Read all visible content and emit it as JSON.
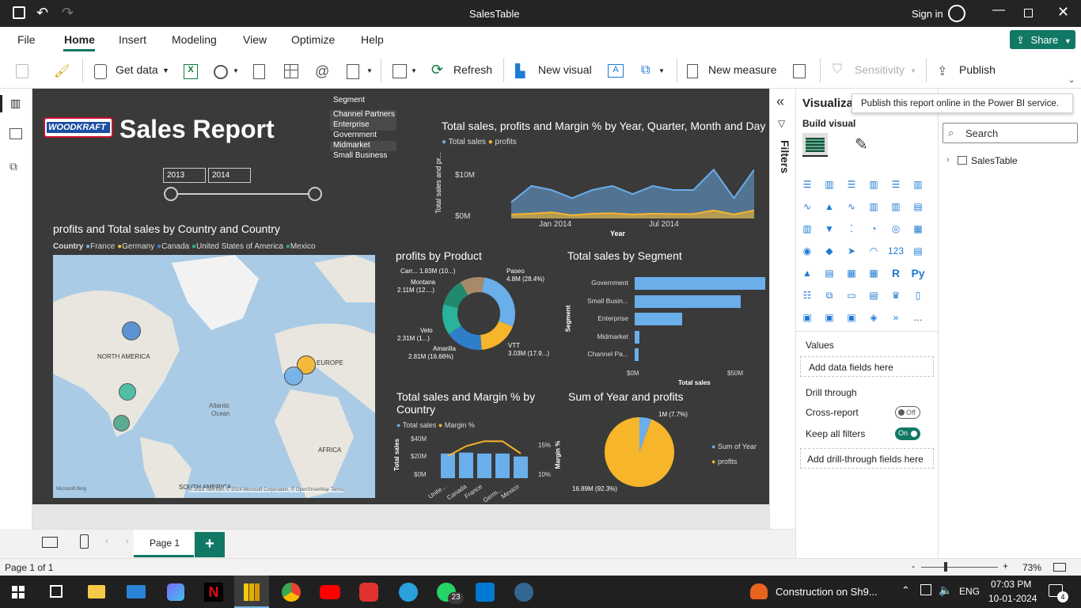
{
  "window": {
    "title": "SalesTable",
    "sign_in": "Sign in"
  },
  "menu": {
    "items": [
      "File",
      "Home",
      "Insert",
      "Modeling",
      "View",
      "Optimize",
      "Help"
    ],
    "active": "Home",
    "share": "Share"
  },
  "ribbon": {
    "get_data": "Get data",
    "refresh": "Refresh",
    "new_visual": "New visual",
    "new_measure": "New measure",
    "sensitivity": "Sensitivity",
    "publish": "Publish"
  },
  "tooltip": "Publish this report online in the Power BI service.",
  "report": {
    "logo": "WOODKRAFT",
    "title": "Sales Report",
    "slicer_year": {
      "from": "2013",
      "to": "2014"
    },
    "segment_slicer": {
      "title": "Segment",
      "items": [
        "Channel Partners",
        "Enterprise",
        "Government",
        "Midmarket",
        "Small Business"
      ],
      "selected": [
        "Channel Partners",
        "Enterprise",
        "Midmarket"
      ]
    },
    "line_chart": {
      "title": "Total sales, profits and Margin % by Year, Quarter, Month and Day",
      "legend": [
        "Total sales",
        "profits"
      ],
      "ylabel": "Total sales and pr...",
      "xlabel": "Year",
      "yticks": [
        "$10M",
        "$0M"
      ],
      "xticks": [
        "Jan 2014",
        "Jul 2014"
      ]
    },
    "map": {
      "title": "profits and Total sales by Country and Country",
      "legend_title": "Country",
      "legend": [
        "France",
        "Germany",
        "Canada",
        "United States of America",
        "Mexico"
      ],
      "labels": [
        "NORTH AMERICA",
        "EUROPE",
        "Atlantic",
        "Ocean",
        "AFRICA",
        "SOUTH AMERICA"
      ],
      "attribution": "© 2023 TomTom, © 2024 Microsoft Corporation, © OpenStreetMap  Terms",
      "bing": "Microsoft Bing"
    },
    "donut": {
      "title": "profits by Product",
      "labels": [
        "Carr... 1.83M (10...)",
        "Montana",
        "2.11M (12....)",
        "Paseo",
        "4.8M (28.4%)",
        "Velo",
        "2.31M (1...)",
        "Amarilla",
        "2.81M (16.66%)",
        "VTT",
        "3.03M (17.9...)"
      ]
    },
    "bar_chart": {
      "title": "Total sales by Segment",
      "ylabel": "Segment",
      "xlabel": "Total sales",
      "xticks": [
        "$0M",
        "$50M"
      ],
      "categories": [
        "Government",
        "Small Busin...",
        "Enterprise",
        "Midmarket",
        "Channel Pa..."
      ]
    },
    "combo_chart": {
      "title": "Total sales and Margin % by Country",
      "legend": [
        "Total sales",
        "Margin %"
      ],
      "ylabel": "Total sales",
      "y2label": "Margin %",
      "yticks": [
        "$40M",
        "$20M",
        "$0M"
      ],
      "y2ticks": [
        "15%",
        "10%"
      ],
      "categories": [
        "Unite...",
        "Canada",
        "France",
        "Germ...",
        "Mexico"
      ]
    },
    "pie": {
      "title": "Sum of Year and profits",
      "label_small": "1M (7.7%)",
      "label_big": "16.89M (92.3%)",
      "legend": [
        "Sum of Year",
        "profits"
      ]
    }
  },
  "filters_label": "Filters",
  "viz_pane": {
    "title": "Visualiza",
    "build_visual": "Build visual",
    "values": "Values",
    "add_fields": "Add data fields here",
    "drill_through": "Drill through",
    "cross_report": "Cross-report",
    "cross_report_state": "Off",
    "keep_filters": "Keep all filters",
    "keep_filters_state": "On",
    "add_drill": "Add drill-through fields here"
  },
  "data_pane": {
    "search_placeholder": "Search",
    "table": "SalesTable"
  },
  "pages": {
    "tab": "Page 1"
  },
  "status": {
    "page": "Page 1 of 1",
    "zoom": "73%"
  },
  "taskbar": {
    "notification": "Construction on Sh9...",
    "lang": "ENG",
    "time": "07:03 PM",
    "date": "10-01-2024",
    "whatsapp_badge": "23",
    "notif_count": "4"
  },
  "chart_data": [
    {
      "type": "area",
      "title": "Total sales, profits and Margin % by Year, Quarter, Month and Day",
      "series": [
        {
          "name": "Total sales",
          "values": [
            4,
            8,
            7,
            5,
            7,
            8,
            6,
            8,
            7,
            7,
            12,
            5,
            12
          ]
        },
        {
          "name": "profits",
          "values": [
            1,
            1.2,
            1.5,
            0.8,
            1.2,
            1.3,
            1,
            1.2,
            1.1,
            1.1,
            2,
            1,
            2
          ]
        }
      ],
      "ylim": [
        0,
        14
      ]
    },
    {
      "type": "bar",
      "title": "Total sales by Segment",
      "categories": [
        "Government",
        "Small Busin...",
        "Enterprise",
        "Midmarket",
        "Channel Pa..."
      ],
      "values": [
        52,
        42,
        19,
        2,
        1.5
      ],
      "xlim": [
        0,
        55
      ]
    },
    {
      "type": "pie",
      "title": "profits by Product",
      "categories": [
        "Paseo",
        "VTT",
        "Amarilla",
        "Velo",
        "Montana",
        "Carretera"
      ],
      "values": [
        4.8,
        3.03,
        2.81,
        2.31,
        2.11,
        1.83
      ]
    },
    {
      "type": "bar",
      "title": "Total sales and Margin % by Country",
      "categories": [
        "Unite...",
        "Canada",
        "France",
        "Germ...",
        "Mexico"
      ],
      "series": [
        {
          "name": "Total sales",
          "values": [
            25,
            26,
            25,
            25,
            22
          ]
        },
        {
          "name": "Margin %",
          "values": [
            12.5,
            14.5,
            15.5,
            15.5,
            13
          ]
        }
      ]
    },
    {
      "type": "pie",
      "title": "Sum of Year and profits",
      "categories": [
        "Sum of Year",
        "profits"
      ],
      "values": [
        1,
        16.89
      ]
    }
  ]
}
